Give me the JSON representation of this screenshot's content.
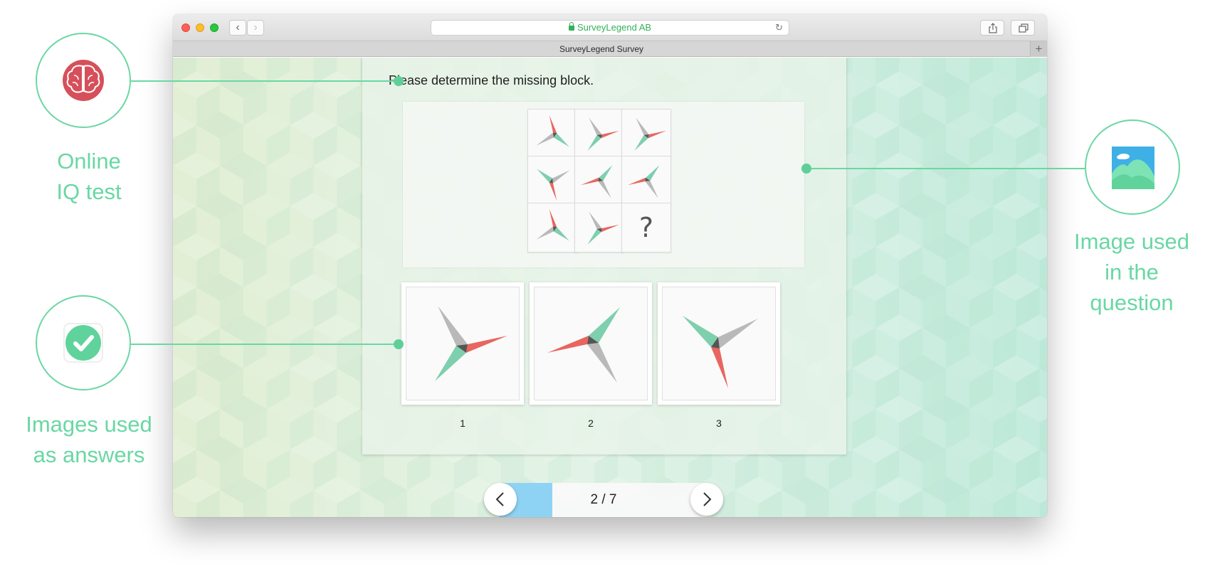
{
  "browser": {
    "address": "SurveyLegend AB",
    "tab_title": "SurveyLegend Survey",
    "new_tab": "+",
    "back": "‹",
    "forward": "›",
    "reload": "↻"
  },
  "survey": {
    "question": "Please determine the missing block.",
    "missing_symbol": "?",
    "answers": [
      {
        "label": "1"
      },
      {
        "label": "2"
      },
      {
        "label": "3"
      }
    ],
    "pager": {
      "text": "2 / 7",
      "current": 2,
      "total": 7
    }
  },
  "callouts": {
    "iq": "Online IQ test",
    "answers": "Images used as answers",
    "question_image": "Image used in the question"
  },
  "colors": {
    "accent": "#6ad7a4",
    "coral": "#e8665f",
    "mint": "#7ecfae",
    "grey": "#b9b9b9",
    "dark": "#555555",
    "brain": "#d6505b",
    "check": "#5fd39b",
    "progress": "#8fd3f4"
  }
}
